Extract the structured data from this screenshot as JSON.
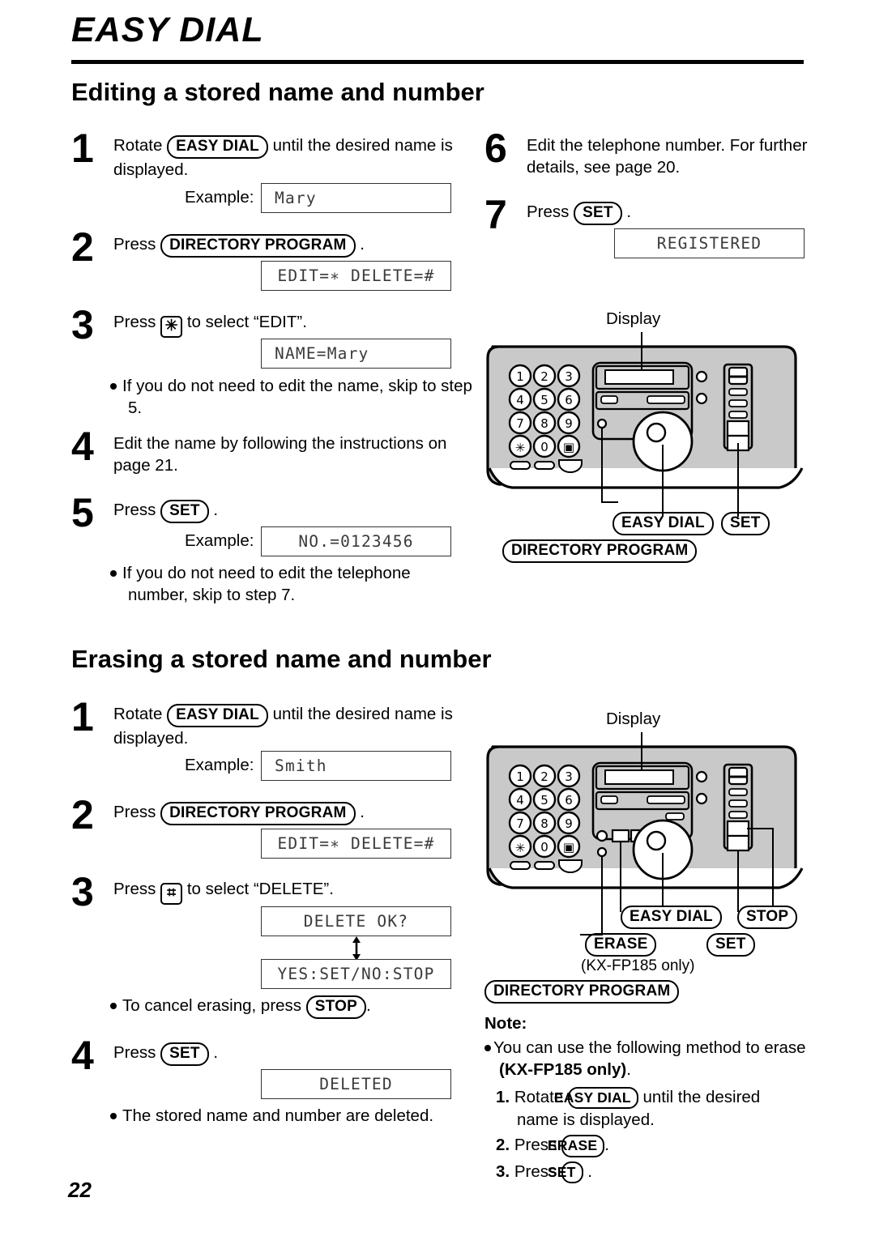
{
  "chapter": {
    "title": "EASY DIAL"
  },
  "page_number": "22",
  "sections": [
    {
      "heading": "Editing a stored name and number",
      "steps": [
        {
          "num": "1",
          "text_before": "Rotate",
          "key": "EASY DIAL",
          "text_after": "until the desired name is displayed.",
          "example_label": "Example:",
          "lcd": "Mary"
        },
        {
          "num": "2",
          "text_before": "Press",
          "key": "DIRECTORY PROGRAM",
          "text_after": ".",
          "lcd": "EDIT=∗ DELETE=#"
        },
        {
          "num": "3",
          "text_before": "Press",
          "key_glyph": "✳",
          "text_after": "to select “EDIT”.",
          "lcd": "NAME=Mary",
          "bullet": "If you do not need to edit the name, skip to step 5."
        },
        {
          "num": "4",
          "text": "Edit the name by following the instructions on page 21."
        },
        {
          "num": "5",
          "text_before": "Press",
          "key": "SET",
          "text_after": ".",
          "example_label": "Example:",
          "lcd": "NO.=0123456",
          "bullet": "If you do not need to edit the telephone number, skip to step 7."
        },
        {
          "num": "6",
          "text": "Edit the telephone number. For further details, see page 20."
        },
        {
          "num": "7",
          "text_before": "Press",
          "key": "SET",
          "text_after": ".",
          "lcd": "REGISTERED"
        }
      ],
      "diagram": {
        "display_label": "Display",
        "callouts": [
          "EASY DIAL",
          "SET",
          "DIRECTORY PROGRAM"
        ],
        "keypad": [
          "1",
          "2",
          "3",
          "4",
          "5",
          "6",
          "7",
          "8",
          "9",
          "∗",
          "0",
          "▣"
        ]
      }
    },
    {
      "heading": "Erasing a stored name and number",
      "steps": [
        {
          "num": "1",
          "text_before": "Rotate",
          "key": "EASY DIAL",
          "text_after": "until the desired name is displayed.",
          "example_label": "Example:",
          "lcd": "Smith"
        },
        {
          "num": "2",
          "text_before": "Press",
          "key": "DIRECTORY PROGRAM",
          "text_after": ".",
          "lcd": "EDIT=∗ DELETE=#"
        },
        {
          "num": "3",
          "text_before": "Press",
          "key_glyph": "⌗",
          "text_after": "to select “DELETE”.",
          "lcd": "DELETE OK?",
          "lcd2": "YES:SET/NO:STOP",
          "bullet_before": "To cancel erasing, press",
          "bullet_key": "STOP",
          "bullet_after": "."
        },
        {
          "num": "4",
          "text_before": "Press",
          "key": "SET",
          "text_after": ".",
          "lcd": "DELETED",
          "bullet": "The stored name and number are deleted."
        }
      ],
      "diagram": {
        "display_label": "Display",
        "callouts": [
          "EASY DIAL",
          "STOP",
          "ERASE",
          "SET",
          "DIRECTORY PROGRAM"
        ],
        "model_note": "(KX-FP185 only)",
        "keypad": [
          "1",
          "2",
          "3",
          "4",
          "5",
          "6",
          "7",
          "8",
          "9",
          "∗",
          "0",
          "▣"
        ]
      },
      "note": {
        "title": "Note:",
        "lead": "You can use the following method to erase",
        "lead_bold": "(KX-FP185 only)",
        "lead_end": ".",
        "items": [
          {
            "n": "1.",
            "before": "Rotate",
            "key": "EASY DIAL",
            "after": "until the desired name is displayed."
          },
          {
            "n": "2.",
            "before": "Press",
            "key": "ERASE",
            "after": "."
          },
          {
            "n": "3.",
            "before": "Press",
            "key": "SET",
            "after": "."
          }
        ]
      }
    }
  ]
}
